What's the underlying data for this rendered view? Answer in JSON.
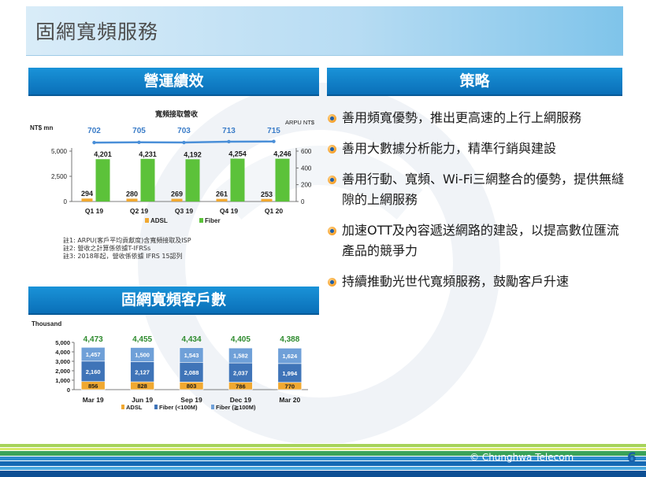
{
  "slide": {
    "title": "固網寬頻服務",
    "left_header": "營運績效",
    "right_header": "策略",
    "bottom_header": "固網寬頻客戶數",
    "copyright": "© Chunghwa Telecom",
    "page_number": "6"
  },
  "strategy": {
    "items": [
      "善用頻寬優勢，推出更高速的上行上網服務",
      "善用大數據分析能力，精準行銷與建設",
      "善用行動、寬頻、Wi-Fi三網整合的優勢，提供無縫隙的上網服務",
      "加速OTT及內容遞送網路的建設，以提高數位匯流產品的競爭力",
      "持續推動光世代寬頻服務，鼓勵客戶升速"
    ]
  },
  "notes": [
    "註1: ARPU(客戶平均貢獻度)含寬頻接取及ISP",
    "註2: 營收之計算係依據T-IFRSs",
    "註3: 2018年起，營收係依據 IFRS 15認列"
  ],
  "colors": {
    "adsl": "#f0a830",
    "fiber": "#5cc23a",
    "arpu_line": "#4a8fd8",
    "arpu_text": "#3a7cc8",
    "header_blue": "#0e7cc6",
    "stack_fiber100": "#2d5c9e",
    "stack_fiberlt100": "#4b86c8",
    "total_text": "#2e8b2e"
  },
  "chart_data": [
    {
      "type": "bar",
      "title": "寬頻接取營收",
      "ylabel": "NT$ mn",
      "y2label": "ARPU NT$",
      "categories": [
        "Q1 19",
        "Q2 19",
        "Q3 19",
        "Q4 19",
        "Q1 20"
      ],
      "ylim": [
        0,
        5000
      ],
      "yticks": [
        "5,000",
        "2,500",
        "0"
      ],
      "y2lim": [
        0,
        600
      ],
      "y2ticks": [
        "600",
        "400",
        "200",
        "0"
      ],
      "series": [
        {
          "name": "ADSL",
          "values": [
            294,
            280,
            269,
            261,
            253
          ],
          "labels": [
            "294",
            "280",
            "269",
            "261",
            "253"
          ]
        },
        {
          "name": "Fiber",
          "values": [
            4201,
            4231,
            4192,
            4254,
            4246
          ],
          "labels": [
            "4,201",
            "4,231",
            "4,192",
            "4,254",
            "4,246"
          ]
        }
      ],
      "arpu": {
        "values": [
          702,
          705,
          703,
          713,
          715
        ],
        "labels": [
          "702",
          "705",
          "703",
          "713",
          "715"
        ]
      },
      "legend": [
        "ADSL",
        "Fiber"
      ]
    },
    {
      "type": "bar",
      "stacked": true,
      "ylabel": "Thousand",
      "categories": [
        "Mar 19",
        "Jun 19",
        "Sep 19",
        "Dec 19",
        "Mar 20"
      ],
      "ylim": [
        0,
        5000
      ],
      "yticks": [
        "5,000",
        "4,000",
        "3,000",
        "2,000",
        "1,000",
        "0"
      ],
      "series": [
        {
          "name": "ADSL",
          "values": [
            856,
            828,
            803,
            786,
            770
          ],
          "labels": [
            "856",
            "828",
            "803",
            "786",
            "770"
          ]
        },
        {
          "name": "Fiber (<100M)",
          "values": [
            2160,
            2127,
            2088,
            2037,
            1994
          ],
          "labels": [
            "2,160",
            "2,127",
            "2,088",
            "2,037",
            "1,994"
          ]
        },
        {
          "name": "Fiber (≧100M)",
          "values": [
            1457,
            1500,
            1543,
            1582,
            1624
          ],
          "labels": [
            "1,457",
            "1,500",
            "1,543",
            "1,582",
            "1,624"
          ]
        }
      ],
      "totals": [
        "4,473",
        "4,455",
        "4,434",
        "4,405",
        "4,388"
      ]
    }
  ]
}
